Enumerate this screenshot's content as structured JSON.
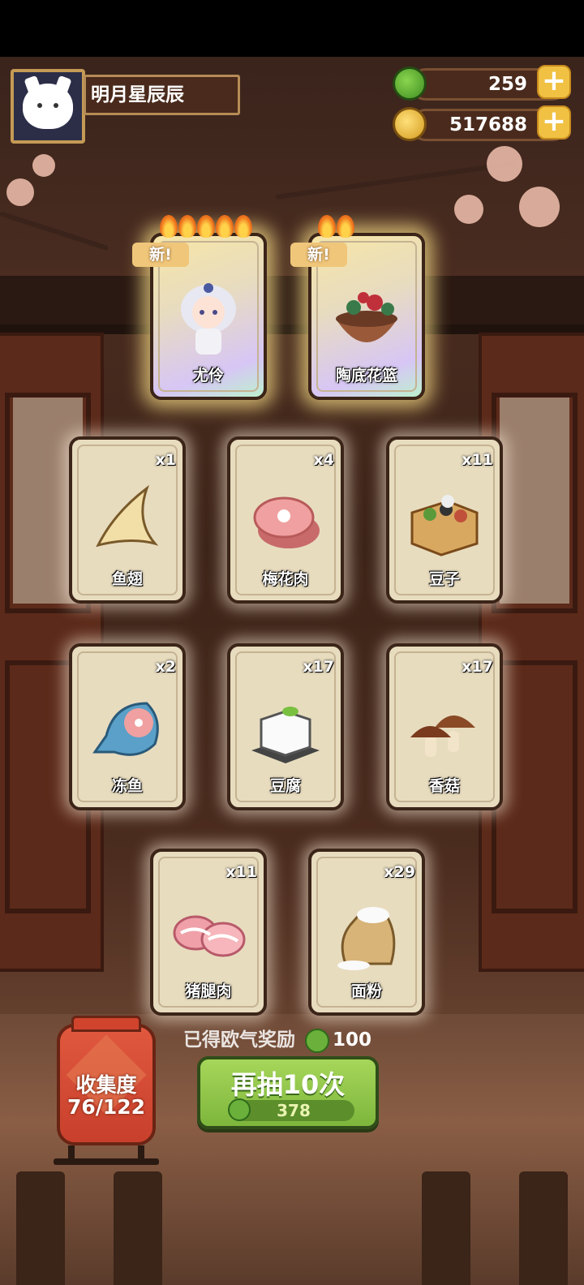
{
  "player": {
    "name": "明月星辰辰"
  },
  "resources": [
    {
      "id": "gem",
      "value": "259",
      "icon": "green-gem-icon",
      "color": "#5aa83a"
    },
    {
      "id": "coin",
      "value": "517688",
      "icon": "gold-coin-icon",
      "color": "#e9b83a"
    }
  ],
  "new_badge": "新",
  "cards": [
    {
      "name": "尤伶",
      "count": "",
      "isNew": true,
      "flames": 5,
      "art": "character-icon"
    },
    {
      "name": "陶底花篮",
      "count": "",
      "isNew": true,
      "flames": 2,
      "art": "flower-basket-icon"
    },
    {
      "name": "鱼翅",
      "count": "x1",
      "isNew": false,
      "flames": 0,
      "art": "shark-fin-icon"
    },
    {
      "name": "梅花肉",
      "count": "x4",
      "isNew": false,
      "flames": 0,
      "art": "pork-shoulder-icon"
    },
    {
      "name": "豆子",
      "count": "x11",
      "isNew": false,
      "flames": 0,
      "art": "beans-box-icon"
    },
    {
      "name": "冻鱼",
      "count": "x2",
      "isNew": false,
      "flames": 0,
      "art": "frozen-fish-icon"
    },
    {
      "name": "豆腐",
      "count": "x17",
      "isNew": false,
      "flames": 0,
      "art": "tofu-icon"
    },
    {
      "name": "香菇",
      "count": "x17",
      "isNew": false,
      "flames": 0,
      "art": "mushroom-icon"
    },
    {
      "name": "猪腿肉",
      "count": "x11",
      "isNew": false,
      "flames": 0,
      "art": "pork-leg-icon"
    },
    {
      "name": "面粉",
      "count": "x29",
      "isNew": false,
      "flames": 0,
      "art": "flour-sack-icon"
    }
  ],
  "reward": {
    "label": "已得欧气奖励",
    "value": "100"
  },
  "draw_button": {
    "label": "再抽10次",
    "cost": "378"
  },
  "collection": {
    "label": "收集度",
    "progress": "76/122"
  }
}
